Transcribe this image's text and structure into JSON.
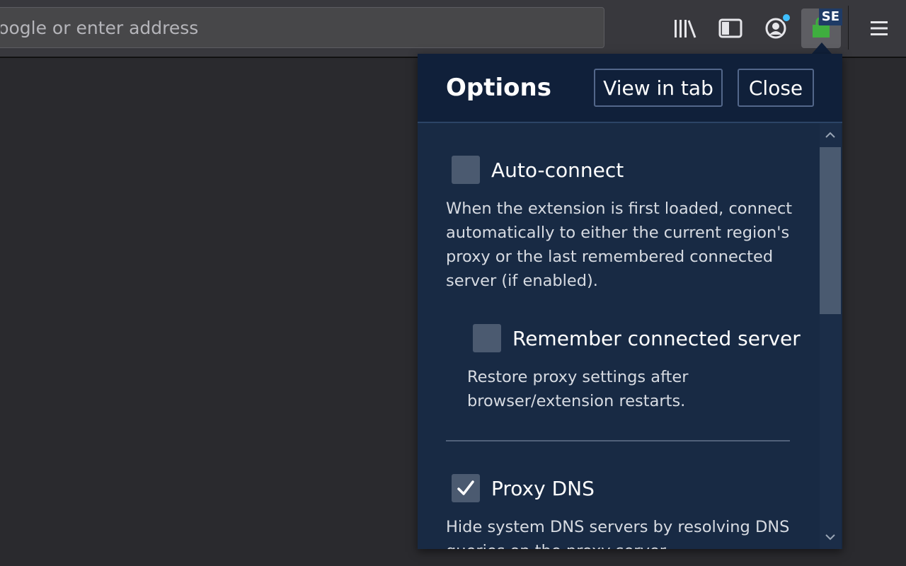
{
  "toolbar": {
    "address_placeholder": "Search with Google or enter address",
    "icons": [
      "library-icon",
      "sidebar-icon",
      "account-icon",
      "extension-icon",
      "menu-icon"
    ],
    "extension_badge": "SE"
  },
  "panel": {
    "title": "Options",
    "view_in_tab": "View in tab",
    "close": "Close",
    "options": [
      {
        "label": "Auto-connect",
        "checked": false,
        "description": "When the extension is first loaded, connect automatically to either the current region's proxy or the last remembered connected server (if enabled)."
      },
      {
        "label": "Remember connected server",
        "checked": false,
        "description": "Restore proxy settings after browser/extension restarts."
      },
      {
        "label": "Proxy DNS",
        "checked": true,
        "description": "Hide system DNS servers by resolving DNS queries on the proxy server."
      }
    ]
  },
  "colors": {
    "panel_bg": "#182a44",
    "panel_header_bg": "#10203a",
    "toolbar_bg": "#38383d",
    "page_bg": "#2a2a2e",
    "extension_green": "#3fae3f"
  }
}
